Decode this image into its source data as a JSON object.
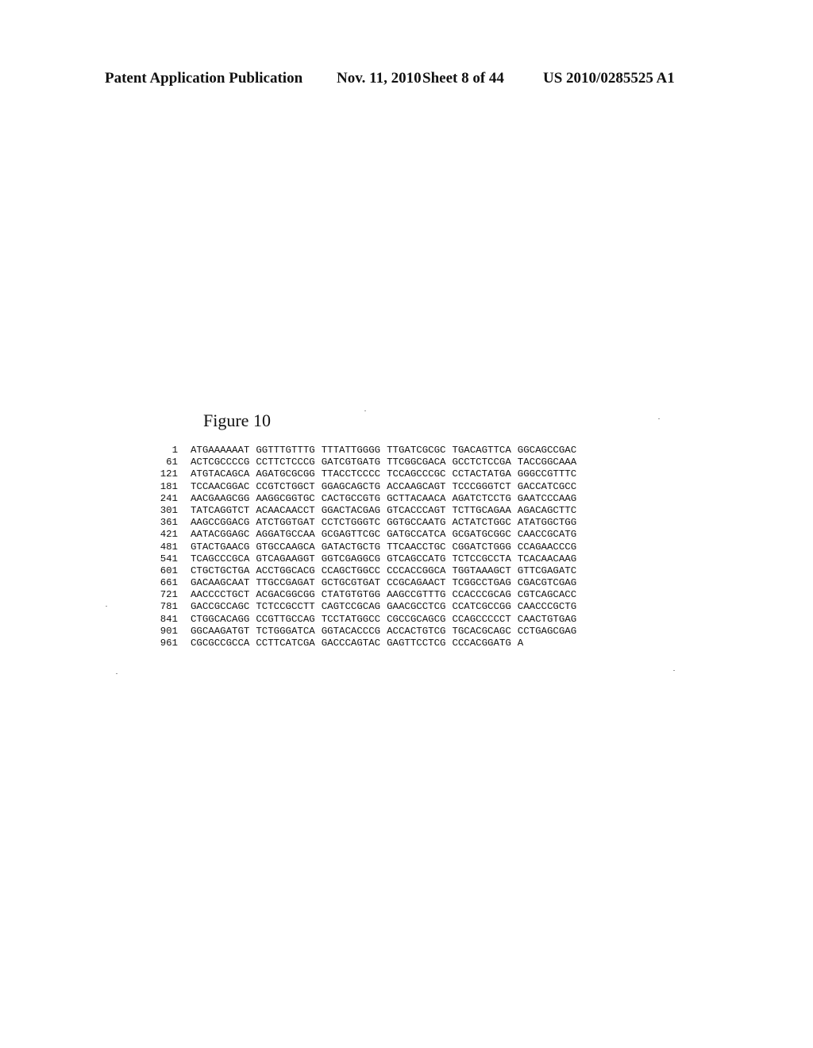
{
  "header": {
    "publication": "Patent Application Publication",
    "date": "Nov. 11, 2010",
    "sheet": "Sheet 8 of 44",
    "number": "US 2010/0285525 A1"
  },
  "figure": {
    "title": "Figure 10",
    "rows": [
      {
        "pos": "1",
        "segments": [
          "ATGAAAAAAT",
          "GGTTTGTTTG",
          "TTTATTGGGG",
          "TTGATCGCGC",
          "TGACAGTTCA",
          "GGCAGCCGAC"
        ]
      },
      {
        "pos": "61",
        "segments": [
          "ACTCGCCCCG",
          "CCTTCTCCCG",
          "GATCGTGATG",
          "TTCGGCGACA",
          "GCCTCTCCGA",
          "TACCGGCAAA"
        ]
      },
      {
        "pos": "121",
        "segments": [
          "ATGTACAGCA",
          "AGATGCGCGG",
          "TTACCTCCCC",
          "TCCAGCCCGC",
          "CCTACTATGA",
          "GGGCCGTTTC"
        ]
      },
      {
        "pos": "181",
        "segments": [
          "TCCAACGGAC",
          "CCGTCTGGCT",
          "GGAGCAGCTG",
          "ACCAAGCAGT",
          "TCCCGGGTCT",
          "GACCATCGCC"
        ]
      },
      {
        "pos": "241",
        "segments": [
          "AACGAAGCGG",
          "AAGGCGGTGC",
          "CACTGCCGTG",
          "GCTTACAACA",
          "AGATCTCCTG",
          "GAATCCCAAG"
        ]
      },
      {
        "pos": "301",
        "segments": [
          "TATCAGGTCT",
          "ACAACAACCT",
          "GGACTACGAG",
          "GTCACCCAGT",
          "TCTTGCAGAA",
          "AGACAGCTTC"
        ]
      },
      {
        "pos": "361",
        "segments": [
          "AAGCCGGACG",
          "ATCTGGTGAT",
          "CCTCTGGGTC",
          "GGTGCCAATG",
          "ACTATCTGGC",
          "ATATGGCTGG"
        ]
      },
      {
        "pos": "421",
        "segments": [
          "AATACGGAGC",
          "AGGATGCCAA",
          "GCGAGTTCGC",
          "GATGCCATCA",
          "GCGATGCGGC",
          "CAACCGCATG"
        ]
      },
      {
        "pos": "481",
        "segments": [
          "GTACTGAACG",
          "GTGCCAAGCA",
          "GATACTGCTG",
          "TTCAACCTGC",
          "CGGATCTGGG",
          "CCAGAACCCG"
        ]
      },
      {
        "pos": "541",
        "segments": [
          "TCAGCCCGCA",
          "GTCAGAAGGT",
          "GGTCGAGGCG",
          "GTCAGCCATG",
          "TCTCCGCCTA",
          "TCACAACAAG"
        ]
      },
      {
        "pos": "601",
        "segments": [
          "CTGCTGCTGA",
          "ACCTGGCACG",
          "CCAGCTGGCC",
          "CCCACCGGCA",
          "TGGTAAAGCT",
          "GTTCGAGATC"
        ]
      },
      {
        "pos": "661",
        "segments": [
          "GACAAGCAAT",
          "TTGCCGAGAT",
          "GCTGCGTGAT",
          "CCGCAGAACT",
          "TCGGCCTGAG",
          "CGACGTCGAG"
        ]
      },
      {
        "pos": "721",
        "segments": [
          "AACCCCTGCT",
          "ACGACGGCGG",
          "CTATGTGTGG",
          "AAGCCGTTTG",
          "CCACCCGCAG",
          "CGTCAGCACC"
        ]
      },
      {
        "pos": "781",
        "segments": [
          "GACCGCCAGC",
          "TCTCCGCCTT",
          "CAGTCCGCAG",
          "GAACGCCTCG",
          "CCATCGCCGG",
          "CAACCCGCTG"
        ]
      },
      {
        "pos": "841",
        "segments": [
          "CTGGCACAGG",
          "CCGTTGCCAG",
          "TCCTATGGCC",
          "CGCCGCAGCG",
          "CCAGCCCCCT",
          "CAACTGTGAG"
        ]
      },
      {
        "pos": "901",
        "segments": [
          "GGCAAGATGT",
          "TCTGGGATCA",
          "GGTACACCCG",
          "ACCACTGTCG",
          "TGCACGCAGC",
          "CCTGAGCGAG"
        ]
      },
      {
        "pos": "961",
        "segments": [
          "CGCGCCGCCA",
          "CCTTCATCGA",
          "GACCCAGTAC",
          "GAGTTCCTCG",
          "CCCACGGATG",
          "A"
        ]
      }
    ]
  }
}
